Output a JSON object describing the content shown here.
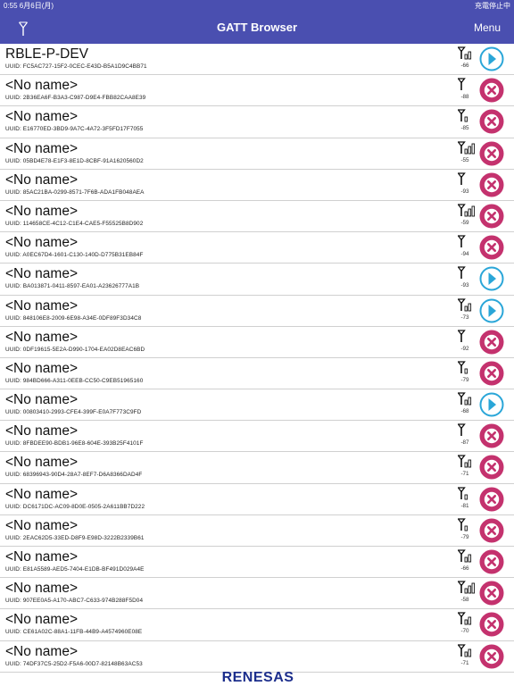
{
  "status": {
    "time": "0:55  6月6日(月)",
    "charge": "充電停止中"
  },
  "nav": {
    "title": "GATT Browser",
    "menu": "Menu"
  },
  "uuid_prefix": "UUID: ",
  "colors": {
    "bar": "#4a4fb0",
    "connect": "#2aa6d8",
    "disconnect": "#c4326e"
  },
  "devices": [
    {
      "name": "RBLE-P-DEV",
      "uuid": "FC5AC727-15F2-0CEC-E43D-B5A1D9C4BB71",
      "rssi": "-66",
      "bars": 2,
      "connectable": true
    },
    {
      "name": "<No name>",
      "uuid": "2B36EA6F-B3A3-C987-D9E4-FBB82CAA8E39",
      "rssi": "-88",
      "bars": 0,
      "connectable": false
    },
    {
      "name": "<No name>",
      "uuid": "E16770ED-3BD9-9A7C-4A72-3F5FD17F7055",
      "rssi": "-85",
      "bars": 1,
      "connectable": false
    },
    {
      "name": "<No name>",
      "uuid": "05BD4E78-E1F3-8E1D-8CBF-91A1620560D2",
      "rssi": "-55",
      "bars": 3,
      "connectable": false
    },
    {
      "name": "<No name>",
      "uuid": "85AC21BA-0299-8571-7F6B-ADA1FB048AEA",
      "rssi": "-93",
      "bars": 0,
      "connectable": false
    },
    {
      "name": "<No name>",
      "uuid": "114658CE-4C12-C1E4-CAE5-F55525B8D902",
      "rssi": "-59",
      "bars": 3,
      "connectable": false
    },
    {
      "name": "<No name>",
      "uuid": "A0EC67D4-1601-C130-140D-D775B31EB84F",
      "rssi": "-94",
      "bars": 0,
      "connectable": false
    },
    {
      "name": "<No name>",
      "uuid": "BA013871-0411-8597-EA01-A23626777A1B",
      "rssi": "-93",
      "bars": 0,
      "connectable": true
    },
    {
      "name": "<No name>",
      "uuid": "848106E8-2009-6E98-A34E-0DF89F3D34C8",
      "rssi": "-73",
      "bars": 2,
      "connectable": true
    },
    {
      "name": "<No name>",
      "uuid": "0DF19615-5E2A-D990-1704-EA02D8EAC6BD",
      "rssi": "-92",
      "bars": 0,
      "connectable": false
    },
    {
      "name": "<No name>",
      "uuid": "984BD666-A311-0EEB-CC50-C9EB51965160",
      "rssi": "-79",
      "bars": 1,
      "connectable": false
    },
    {
      "name": "<No name>",
      "uuid": "00803410-2993-CFE4-399F-E0A7F773C9FD",
      "rssi": "-68",
      "bars": 2,
      "connectable": true
    },
    {
      "name": "<No name>",
      "uuid": "8FBDEE90-BDB1-96E8-604E-393B25F4101F",
      "rssi": "-87",
      "bars": 0,
      "connectable": false
    },
    {
      "name": "<No name>",
      "uuid": "68396943-90D4-28A7-8EF7-D6A8366DAD4F",
      "rssi": "-71",
      "bars": 2,
      "connectable": false
    },
    {
      "name": "<No name>",
      "uuid": "DC6171DC-AC09-8D0E-0505-2A611BB7D222",
      "rssi": "-81",
      "bars": 1,
      "connectable": false
    },
    {
      "name": "<No name>",
      "uuid": "2EAC62D5-33ED-D8F9-E98D-3222B2339B61",
      "rssi": "-79",
      "bars": 1,
      "connectable": false
    },
    {
      "name": "<No name>",
      "uuid": "E81A5589-AED5-7404-E1DB-BF491D029A4E",
      "rssi": "-66",
      "bars": 2,
      "connectable": false
    },
    {
      "name": "<No name>",
      "uuid": "907EE0A5-A170-ABC7-C633-974B288F5D04",
      "rssi": "-58",
      "bars": 3,
      "connectable": false
    },
    {
      "name": "<No name>",
      "uuid": "CE61A02C-88A1-11FB-44B9-A4574960E08E",
      "rssi": "-70",
      "bars": 2,
      "connectable": false
    },
    {
      "name": "<No name>",
      "uuid": "74DF37C5-25D2-F5A6-00D7-82148B63AC53",
      "rssi": "-71",
      "bars": 2,
      "connectable": false
    }
  ],
  "footer": {
    "logo_text": "RENESAS"
  }
}
